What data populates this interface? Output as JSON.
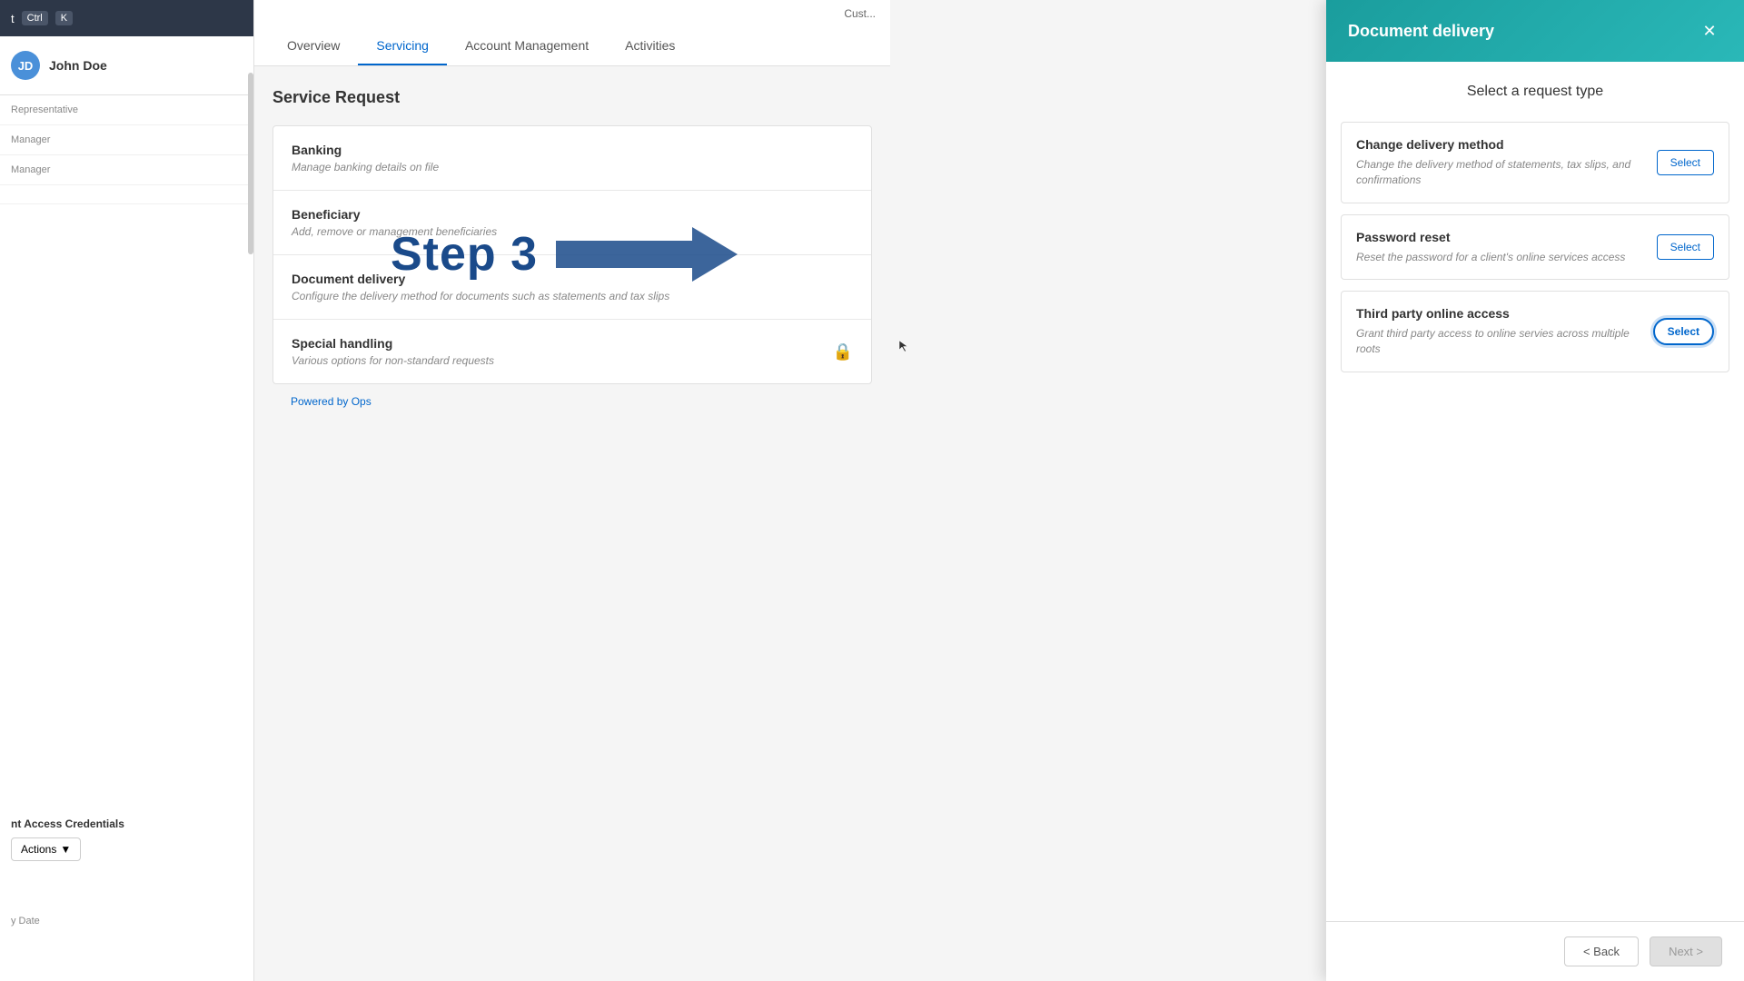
{
  "sidebar": {
    "topbar": {
      "text": "t",
      "kbd1": "Ctrl",
      "kbd2": "K"
    },
    "user": {
      "name": "John Doe",
      "initials": "JD"
    },
    "fields": [
      {
        "label": "Representative",
        "value": ""
      },
      {
        "label": "Manager",
        "value": ""
      },
      {
        "label": "Manager",
        "value": ""
      }
    ],
    "credentials_title": "nt Access Credentials",
    "actions_label": "Actions",
    "bottom_field": "y Date"
  },
  "main": {
    "cust_btn": "Cust...",
    "tabs": [
      {
        "label": "Overview",
        "active": false
      },
      {
        "label": "Servicing",
        "active": true
      },
      {
        "label": "Account Management",
        "active": false
      },
      {
        "label": "Activities",
        "active": false
      }
    ],
    "service_request_title": "Service Request",
    "service_items": [
      {
        "name": "Banking",
        "desc": "Manage banking details on file",
        "has_lock": false
      },
      {
        "name": "Beneficiary",
        "desc": "Add, remove or management beneficiaries",
        "has_lock": false
      },
      {
        "name": "Document delivery",
        "desc": "Configure the delivery method for documents such as statements and tax slips",
        "has_lock": false
      },
      {
        "name": "Special handling",
        "desc": "Various options for non-standard requests",
        "has_lock": true
      }
    ],
    "powered_by_text": "Powered by",
    "powered_by_brand": "Ops"
  },
  "step3": {
    "label": "Step 3"
  },
  "right_panel": {
    "title": "Document delivery",
    "subtitle": "Select a request type",
    "request_items": [
      {
        "name": "Change delivery method",
        "desc": "Change the delivery method of statements, tax slips, and confirmations",
        "select_label": "Select",
        "highlighted": false
      },
      {
        "name": "Password reset",
        "desc": "Reset the password for a client's online services access",
        "select_label": "Select",
        "highlighted": false
      },
      {
        "name": "Third party online access",
        "desc": "Grant third party access to online servies across multiple roots",
        "select_label": "Select",
        "highlighted": true
      }
    ],
    "back_label": "< Back",
    "next_label": "Next >"
  }
}
